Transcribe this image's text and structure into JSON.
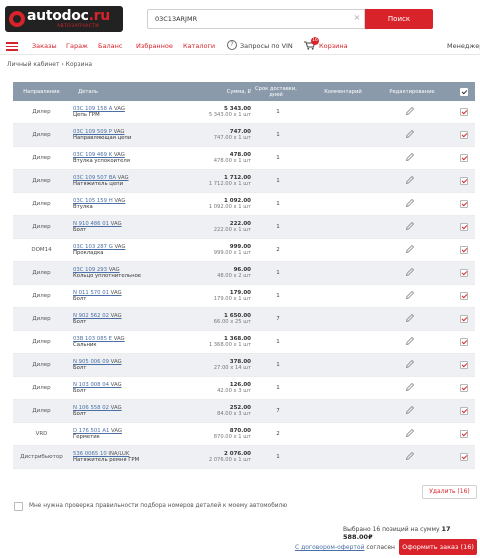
{
  "header": {
    "logo_main": "autodoc",
    "logo_tld": ".ru",
    "logo_sub": "АВТОЗАПЧАСТИ",
    "search_value": "03C13ARJMR",
    "search_button": "Поиск"
  },
  "nav": {
    "items": [
      "Заказы",
      "Гараж",
      "Баланс",
      "Избранное",
      "Каталоги"
    ],
    "vin_label": "Запросы по VIN",
    "cart_label": "Корзина",
    "cart_count": "16",
    "user_label": "Менеджер"
  },
  "breadcrumb": "Личный кабинет › Корзина",
  "table": {
    "headers": {
      "direction": "Направление",
      "part": "Деталь",
      "sum": "Сумма, ₽",
      "term": "Срок доставки, дней",
      "comment": "Комментарий",
      "edit": "Редактирование"
    },
    "rows": [
      {
        "direction": "Дилер",
        "code": "03C 109 158 A",
        "brand": "VAG",
        "name": "Цепь ГРМ",
        "price": "5 343.00",
        "qty": "5 343.00 x 1 шт",
        "term": "1"
      },
      {
        "direction": "Дилер",
        "code": "03C 109 509 P",
        "brand": "VAG",
        "name": "Направляющая цепи",
        "price": "747.00",
        "qty": "747.00 x 1 шт",
        "term": "1"
      },
      {
        "direction": "Дилер",
        "code": "03C 109 469 K",
        "brand": "VAG",
        "name": "Втулка успокоителя",
        "price": "478.00",
        "qty": "478.00 x 1 шт",
        "term": "1"
      },
      {
        "direction": "Дилер",
        "code": "03C 109 507 BA",
        "brand": "VAG",
        "name": "Натяжитель цепи",
        "price": "1 712.00",
        "qty": "1 712.00 x 1 шт",
        "term": "1"
      },
      {
        "direction": "Дилер",
        "code": "03C 105 159 H",
        "brand": "VAG",
        "name": "Втулка",
        "price": "1 092.00",
        "qty": "1 092.00 x 1 шт",
        "term": "1"
      },
      {
        "direction": "Дилер",
        "code": "N 910 486 01",
        "brand": "VAG",
        "name": "Болт",
        "price": "222.00",
        "qty": "222.00 x 1 шт",
        "term": "1"
      },
      {
        "direction": "DOM14",
        "code": "03C 103 287 G",
        "brand": "VAG",
        "name": "Прокладка",
        "price": "999.00",
        "qty": "999.00 x 1 шт",
        "term": "2"
      },
      {
        "direction": "Дилер",
        "code": "03C 109 293",
        "brand": "VAG",
        "name": "Кольцо уплотнительное",
        "price": "96.00",
        "qty": "48.00 x 2 шт",
        "term": "1"
      },
      {
        "direction": "Дилер",
        "code": "N 011 570 01",
        "brand": "VAG",
        "name": "Болт",
        "price": "179.00",
        "qty": "179.00 x 1 шт",
        "term": "1"
      },
      {
        "direction": "Дилер",
        "code": "N 902 562 02",
        "brand": "VAG",
        "name": "Болт",
        "price": "1 650.00",
        "qty": "66.00 x 25 шт",
        "term": "7"
      },
      {
        "direction": "Дилер",
        "code": "03B 103 085 E",
        "brand": "VAG",
        "name": "Сальник",
        "price": "1 368.00",
        "qty": "1 368.00 x 1 шт",
        "term": "1"
      },
      {
        "direction": "Дилер",
        "code": "N 905 006 09",
        "brand": "VAG",
        "name": "Болт",
        "price": "378.00",
        "qty": "27.00 x 14 шт",
        "term": "1"
      },
      {
        "direction": "Дилер",
        "code": "N 103 008 04",
        "brand": "VAG",
        "name": "Болт",
        "price": "126.00",
        "qty": "42.00 x 3 шт",
        "term": "1"
      },
      {
        "direction": "Дилер",
        "code": "N 106 558 02",
        "brand": "VAG",
        "name": "Болт",
        "price": "252.00",
        "qty": "84.00 x 3 шт",
        "term": "7"
      },
      {
        "direction": "VRD",
        "code": "D 176 501 A1",
        "brand": "VAG",
        "name": "Герметик",
        "price": "870.00",
        "qty": "870.00 x 1 шт",
        "term": "2"
      },
      {
        "direction": "Дистрибьютор",
        "code": "536 0065 10",
        "brand": "INA/LUK",
        "name": "Натяжитель ремня ГРМ",
        "price": "2 076.00",
        "qty": "2 076.00 x 1 шт",
        "term": "1"
      }
    ]
  },
  "footer": {
    "delete_button": "Удалить (16)",
    "verify_text": "Мне нужна проверка правильности подбора номеров деталей к моему автомобилю",
    "summary_prefix": "Выбрано 16 позиций на сумму",
    "summary_total": "17 588.00₽",
    "offer_link": "С договором-офертой",
    "offer_suffix": "согласен",
    "order_button": "Оформить заказ (16)"
  },
  "colors": {
    "accent": "#d8232a",
    "header_bg": "#8a9aab",
    "link": "#4a6fa5"
  }
}
